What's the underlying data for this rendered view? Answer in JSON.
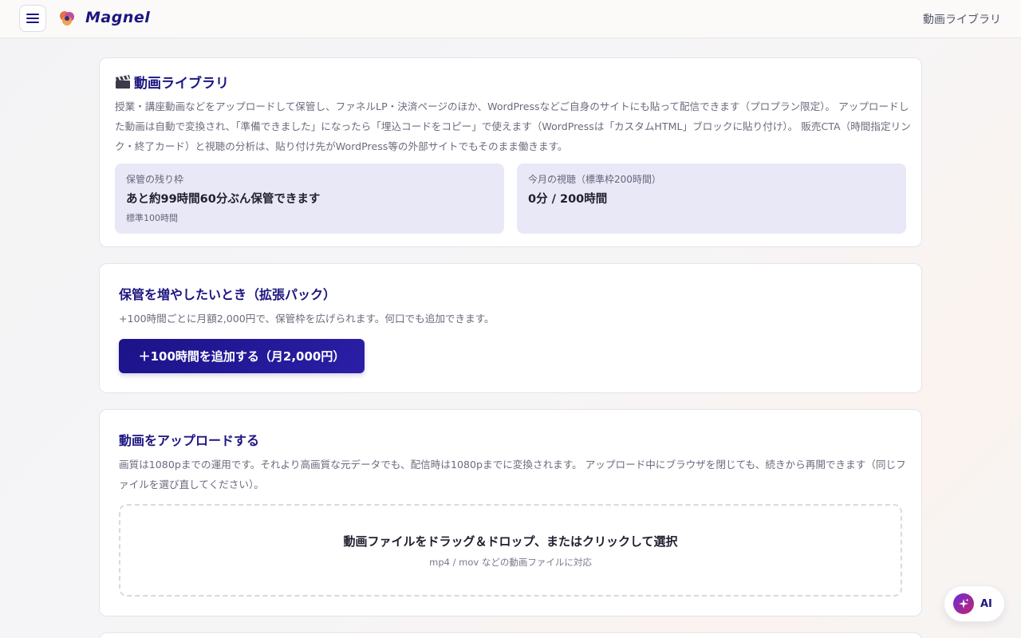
{
  "header": {
    "brand": "Magnel",
    "page_title": "動画ライブラリ"
  },
  "library": {
    "title": "動画ライブラリ",
    "description": "授業・講座動画などをアップロードして保管し、ファネルLP・決済ページのほか、WordPressなどご自身のサイトにも貼って配信できます（プロプラン限定）。 アップロードした動画は自動で変換され、「準備できました」になったら「埋込コードをコピー」で使えます（WordPressは「カスタムHTML」ブロックに貼り付け）。 販売CTA（時間指定リンク・終了カード）と視聴の分析は、貼り付け先がWordPress等の外部サイトでもそのまま働きます。",
    "storage": {
      "label": "保管の残り枠",
      "value": "あと約99時間60分ぶん保管できます",
      "sub": "標準100時間"
    },
    "views": {
      "label": "今月の視聴（標準枠200時間）",
      "value": "0分 / 200時間"
    }
  },
  "expansion": {
    "title": "保管を増やしたいとき（拡張パック）",
    "description": "+100時間ごとに月額2,000円で、保管枠を広げられます。何口でも追加できます。",
    "button_label": "＋100時間を追加する（月2,000円）"
  },
  "upload": {
    "title": "動画をアップロードする",
    "description": "画質は1080pまでの運用です。それより高画質な元データでも、配信時は1080pまでに変換されます。 アップロード中にブラウザを閉じても、続きから再開できます（同じファイルを選び直してください）。",
    "drop_main": "動画ファイルをドラッグ＆ドロップ、またはクリックして選択",
    "drop_sub": "mp4 / mov などの動画ファイルに対応"
  },
  "ai_button": {
    "label": "AI"
  },
  "colors": {
    "brand": "#1c1680",
    "stat_bg": "#e9e8f7",
    "button": "#1c1288",
    "ai_gradient_start": "#6b2bd9",
    "ai_gradient_end": "#c0266f"
  },
  "icons": {
    "menu": "hamburger-icon",
    "logo": "magnel-logo-icon",
    "library": "clapperboard-icon",
    "ai": "sparkle-icon"
  }
}
